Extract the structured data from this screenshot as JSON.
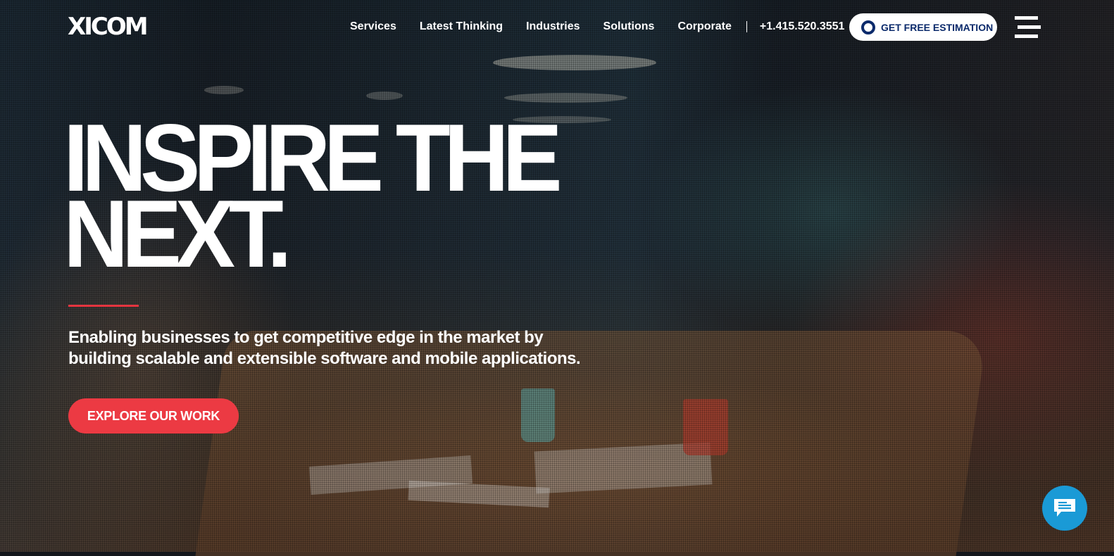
{
  "brand": {
    "logo_text": "XICOM"
  },
  "nav": {
    "items": [
      {
        "label": "Services"
      },
      {
        "label": "Latest Thinking"
      },
      {
        "label": "Industries"
      },
      {
        "label": "Solutions"
      },
      {
        "label": "Corporate"
      }
    ],
    "phone": "+1.415.520.3551",
    "cta_label": "GET FREE ESTIMATION",
    "menu_icon": "hamburger-icon"
  },
  "hero": {
    "headline_line1": "INSPIRE THE",
    "headline_line2": "NEXT.",
    "subtitle": "Enabling businesses to get competitive edge in the market by building scalable and extensible software and mobile applications.",
    "button_label": "EXPLORE OUR WORK"
  },
  "chat": {
    "icon": "chat-bubble-icon"
  },
  "colors": {
    "accent_red": "#ec3a43",
    "cta_text_navy": "#0b2a6b",
    "chat_blue": "#1a9ad6"
  }
}
